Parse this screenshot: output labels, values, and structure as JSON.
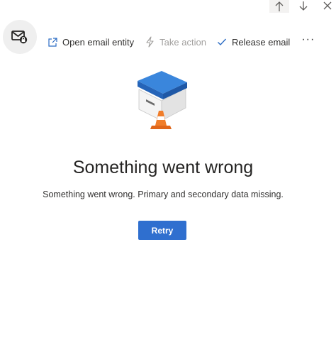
{
  "toolbar": {
    "open_email_entity": "Open email entity",
    "take_action": "Take action",
    "release_email": "Release email",
    "more": "···"
  },
  "error": {
    "title": "Something went wrong",
    "message": "Something went wrong. Primary and secondary data missing.",
    "retry_label": "Retry"
  },
  "icons": {
    "nav_up": "arrow-up-icon",
    "nav_down": "arrow-down-icon",
    "close": "close-icon",
    "entity": "email-entity-icon",
    "open": "open-external-icon",
    "take_action": "lightning-icon",
    "release": "checkmark-icon",
    "illustration": "empty-box-with-cone"
  },
  "colors": {
    "accent": "#2f6fcf",
    "command_icon": "#2b6cc4",
    "disabled_text": "#a19f9d",
    "box_lid": "#2b73c8",
    "cone": "#f07d2a"
  }
}
